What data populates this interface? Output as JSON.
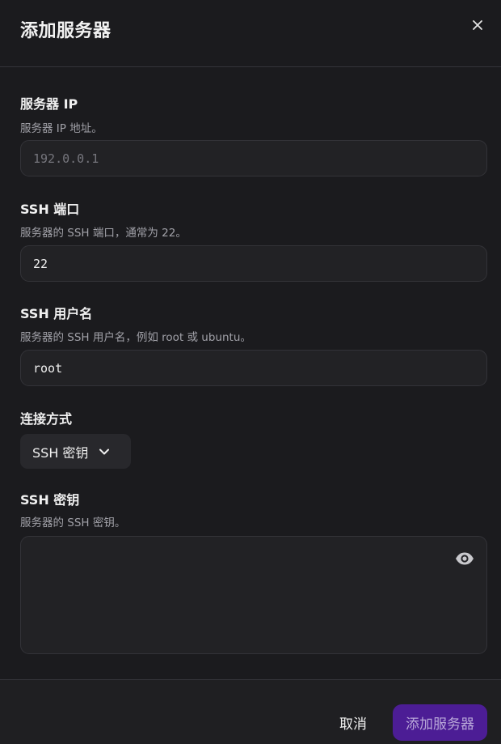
{
  "dialog": {
    "title": "添加服务器",
    "close_icon": "close-icon"
  },
  "fields": {
    "ip": {
      "label": "服务器 IP",
      "description": "服务器 IP 地址。",
      "value": "",
      "placeholder": "192.0.0.1"
    },
    "port": {
      "label": "SSH 端口",
      "description": "服务器的 SSH 端口，通常为 22。",
      "value": "22"
    },
    "username": {
      "label": "SSH 用户名",
      "description": "服务器的 SSH 用户名，例如 root 或 ubuntu。",
      "value": "root"
    },
    "method": {
      "label": "连接方式",
      "selected": "SSH 密钥",
      "icon": "chevron-down-icon"
    },
    "key": {
      "label": "SSH 密钥",
      "description": "服务器的 SSH 密钥。",
      "value": "",
      "icon": "eye-icon"
    }
  },
  "footer": {
    "cancel_label": "取消",
    "submit_label": "添加服务器"
  },
  "colors": {
    "background": "#1b1b1e",
    "input_background": "#222225",
    "accent": "#4c1d95",
    "text_muted": "#a1a1a8"
  }
}
